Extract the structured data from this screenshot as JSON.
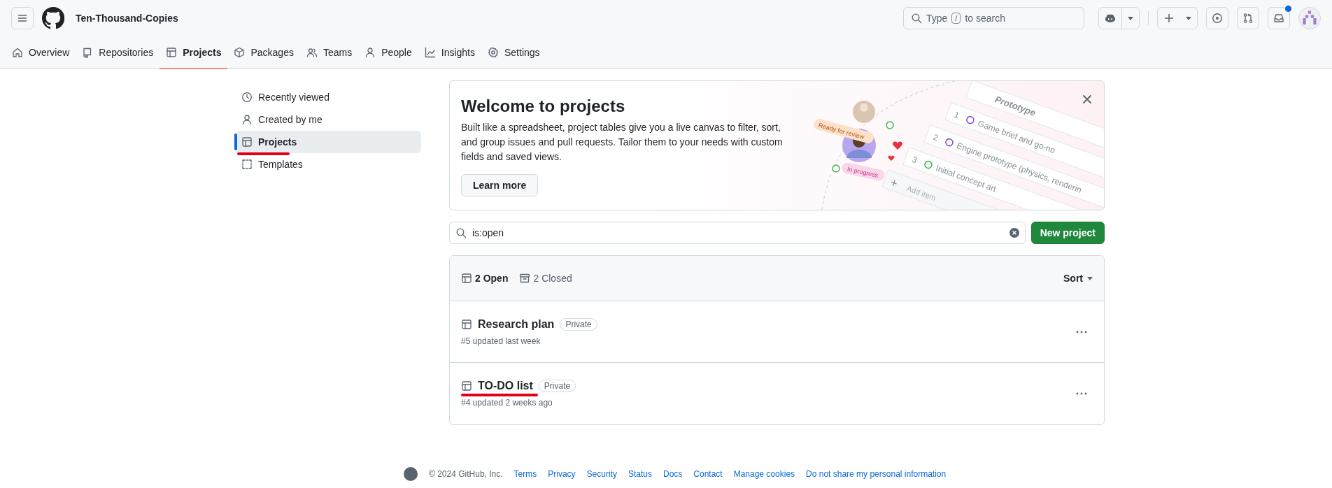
{
  "header": {
    "org_name": "Ten-Thousand-Copies",
    "search_placeholder_before": "Type",
    "search_key": "/",
    "search_placeholder_after": "to search",
    "inbox_unread": true
  },
  "tabs": [
    {
      "label": "Overview",
      "selected": false
    },
    {
      "label": "Repositories",
      "selected": false
    },
    {
      "label": "Projects",
      "selected": true
    },
    {
      "label": "Packages",
      "selected": false
    },
    {
      "label": "Teams",
      "selected": false
    },
    {
      "label": "People",
      "selected": false
    },
    {
      "label": "Insights",
      "selected": false
    },
    {
      "label": "Settings",
      "selected": false
    }
  ],
  "sidebar": {
    "items": [
      {
        "label": "Recently viewed",
        "selected": false,
        "underlined": false
      },
      {
        "label": "Created by me",
        "selected": false,
        "underlined": false
      },
      {
        "label": "Projects",
        "selected": true,
        "underlined": true
      },
      {
        "label": "Templates",
        "selected": false,
        "underlined": false
      }
    ]
  },
  "banner": {
    "title": "Welcome to projects",
    "text": "Built like a spreadsheet, project tables give you a live canvas to filter, sort, and group issues and pull requests. Tailor them to your needs with custom fields and saved views.",
    "button": "Learn more",
    "illustration": {
      "group_title": "Prototype",
      "rows": [
        {
          "number": "1",
          "title": "Game brief and go-no"
        },
        {
          "number": "2",
          "title": "Engine prototype (physics, renderin"
        },
        {
          "number": "3",
          "title": "Initial concept art"
        }
      ],
      "add_item": "Add item",
      "tags": [
        "Ready for review",
        "In progress"
      ]
    }
  },
  "filter": {
    "value": "is:open",
    "new_button": "New project"
  },
  "list": {
    "open_count": "2 Open",
    "closed_count": "2 Closed",
    "sort": "Sort",
    "projects": [
      {
        "title": "Research plan",
        "visibility": "Private",
        "meta": "#5 updated last week",
        "underlined": false
      },
      {
        "title": "TO-DO list",
        "visibility": "Private",
        "meta": "#4 updated 2 weeks ago",
        "underlined": true
      }
    ]
  },
  "footer": {
    "copyright": "© 2024 GitHub, Inc.",
    "links": [
      "Terms",
      "Privacy",
      "Security",
      "Status",
      "Docs",
      "Contact",
      "Manage cookies",
      "Do not share my personal information"
    ]
  }
}
